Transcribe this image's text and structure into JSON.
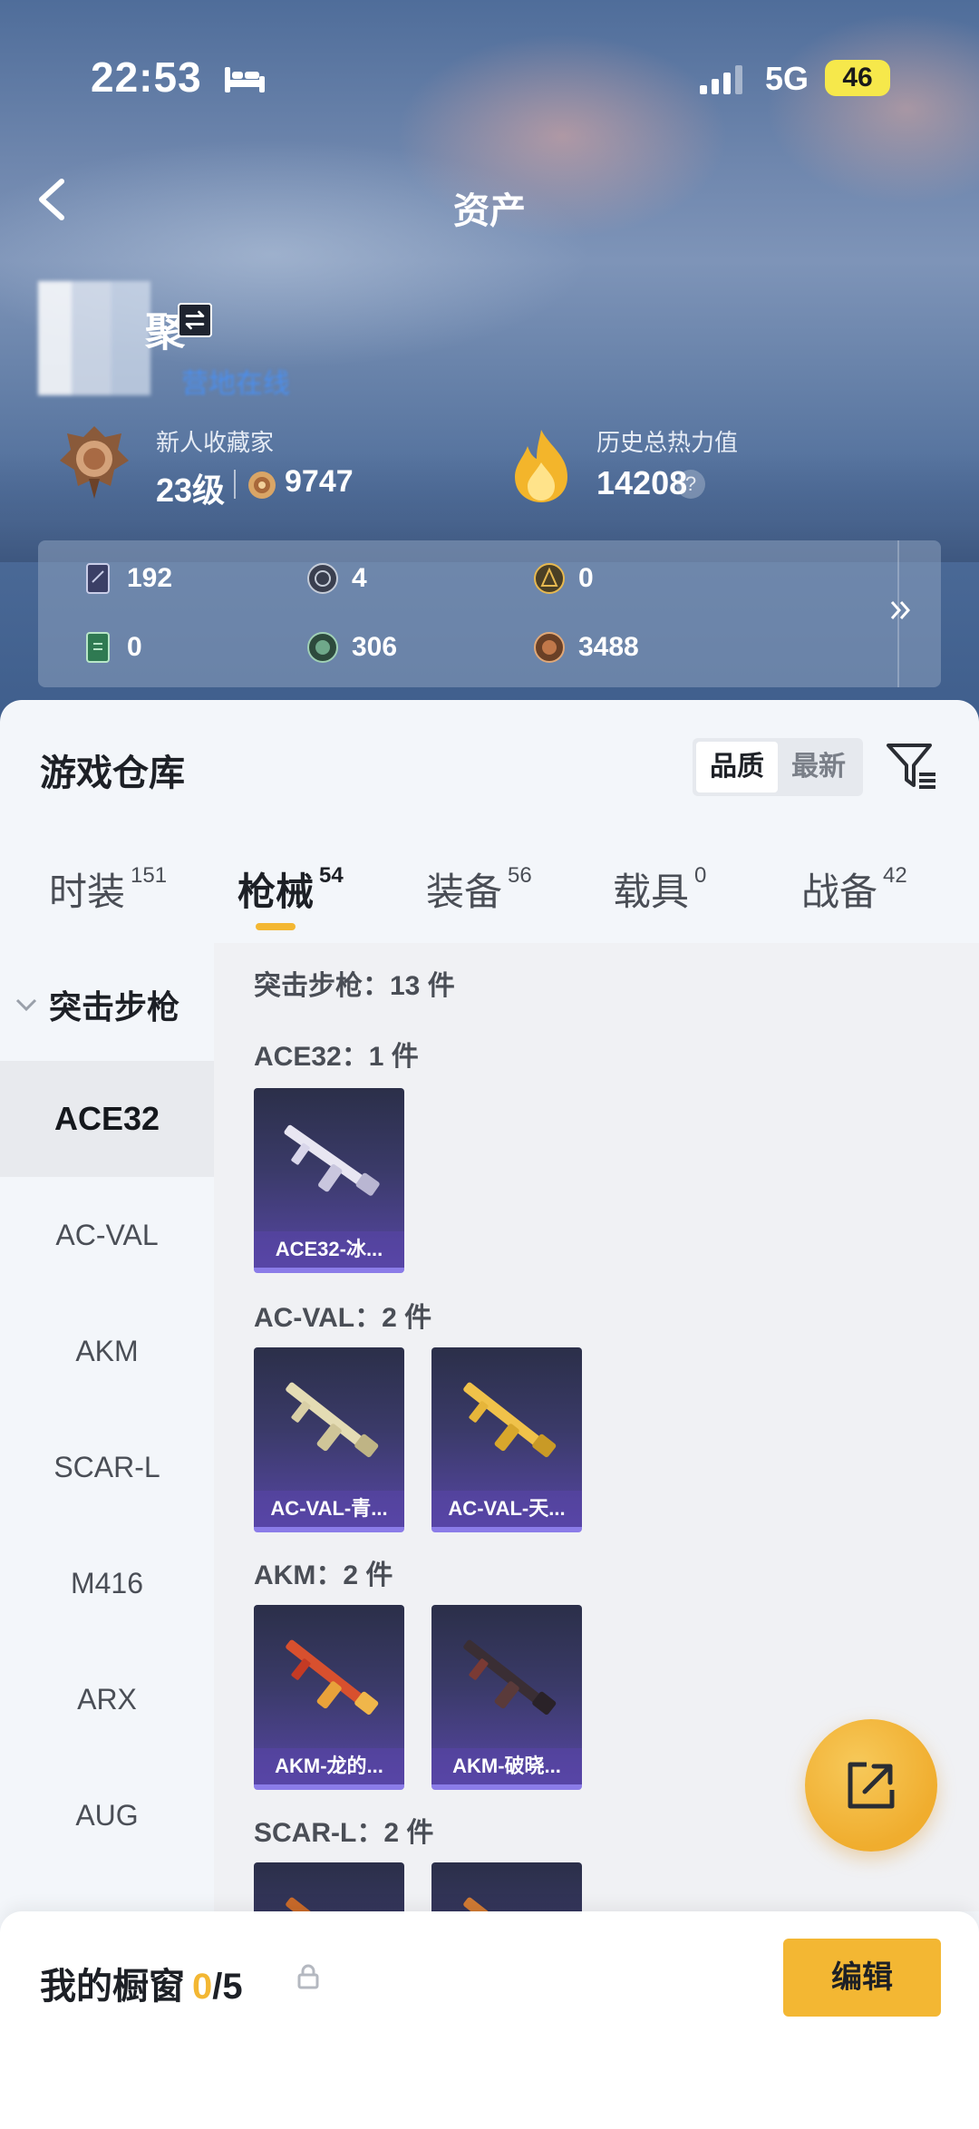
{
  "status_bar": {
    "time": "22:53",
    "network": "5G",
    "battery": "46"
  },
  "nav": {
    "title": "资产"
  },
  "user": {
    "name_tail": "聚",
    "online_status": "营地在线"
  },
  "rank": {
    "title": "新人收藏家",
    "level": "23级",
    "points": "9747"
  },
  "heat": {
    "title": "历史总热力值",
    "value": "14208",
    "help": "?"
  },
  "currencies": [
    {
      "icon": "card-icon",
      "value": "192"
    },
    {
      "icon": "silver-coin-icon",
      "value": "4"
    },
    {
      "icon": "gold-coin-icon",
      "value": "0"
    },
    {
      "icon": "ticket-icon",
      "value": "0"
    },
    {
      "icon": "green-coin-icon",
      "value": "306"
    },
    {
      "icon": "bronze-coin-icon",
      "value": "3488"
    }
  ],
  "warehouse": {
    "title": "游戏仓库",
    "sort_options": [
      "品质",
      "最新"
    ],
    "tabs": [
      {
        "label": "时装",
        "count": "151"
      },
      {
        "label": "枪械",
        "count": "54"
      },
      {
        "label": "装备",
        "count": "56"
      },
      {
        "label": "载具",
        "count": "0"
      },
      {
        "label": "战备",
        "count": "42"
      }
    ],
    "category_header": "突击步枪",
    "categories": [
      "ACE32",
      "AC-VAL",
      "AKM",
      "SCAR-L",
      "M416",
      "ARX",
      "AUG"
    ],
    "summary": "突击步枪：13 件",
    "sections": [
      {
        "label": "ACE32：1 件",
        "items": [
          "ACE32-冰..."
        ]
      },
      {
        "label": "AC-VAL：2 件",
        "items": [
          "AC-VAL-青...",
          "AC-VAL-天..."
        ]
      },
      {
        "label": "AKM：2 件",
        "items": [
          "AKM-龙的...",
          "AKM-破晓..."
        ]
      },
      {
        "label": "SCAR-L：2 件",
        "items": [
          "",
          ""
        ]
      }
    ]
  },
  "showcase": {
    "label": "我的橱窗",
    "current": "0",
    "total": "/5",
    "edit_label": "编辑"
  },
  "colors": {
    "accent": "#f3b733",
    "card_purple": "#5646a3",
    "link_blue": "#4a8ff0"
  }
}
